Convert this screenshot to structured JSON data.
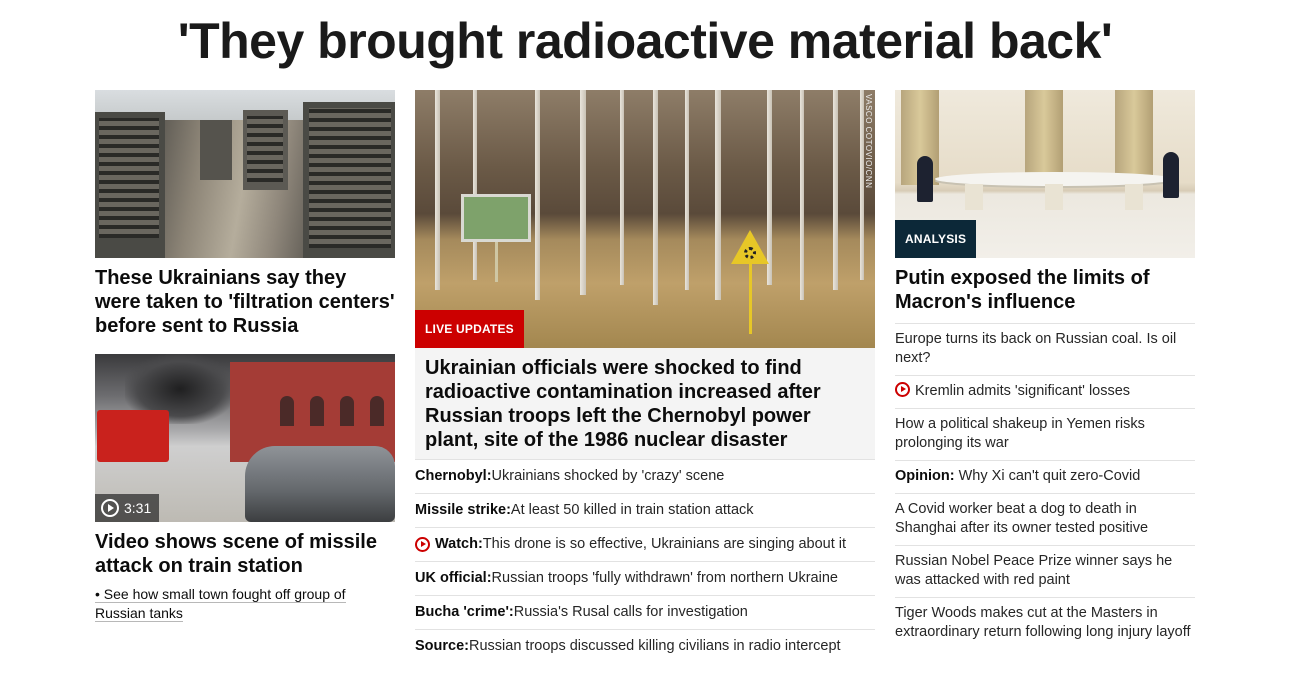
{
  "main_headline": "'They brought radioactive material back'",
  "left": {
    "story1": {
      "title": "These Ukrainians say they were taken to 'filtration centers' before sent to Russia"
    },
    "story2": {
      "duration": "3:31",
      "title": "Video shows scene of missile attack on train station",
      "sublink": "• See how small town fought off group of Russian tanks"
    }
  },
  "middle": {
    "label": "LIVE UPDATES",
    "photo_credit": "VASCO COTOVIO/CNN",
    "headline": "Ukrainian officials were shocked to find radioactive contamination increased after Russian troops left the Chernobyl power plant, site of the 1986 nuclear disaster",
    "items": [
      {
        "bold": "Chernobyl:",
        "text": " Ukrainians shocked by 'crazy' scene"
      },
      {
        "bold": "Missile strike:",
        "text": " At least 50 killed in train station attack"
      },
      {
        "bold": "Watch:",
        "text": " This drone is so effective, Ukrainians are singing about it"
      },
      {
        "bold": "UK official:",
        "text": " Russian troops 'fully withdrawn' from northern Ukraine"
      },
      {
        "bold": "Bucha 'crime':",
        "text": " Russia's Rusal calls for investigation"
      },
      {
        "bold": "Source:",
        "text": " Russian troops discussed killing civilians in radio intercept"
      }
    ]
  },
  "right": {
    "label": "ANALYSIS",
    "title": "Putin exposed the limits of Macron's influence",
    "items": [
      {
        "text": "Europe turns its back on Russian coal. Is oil next?"
      },
      {
        "text": "Kremlin admits 'significant' losses"
      },
      {
        "text": "How a political shakeup in Yemen risks prolonging its war"
      },
      {
        "bold": "Opinion:",
        "text": " Why Xi can't quit zero-Covid"
      },
      {
        "text": "A Covid worker beat a dog to death in Shanghai after its owner tested positive"
      },
      {
        "text": "Russian Nobel Peace Prize winner says he was attacked with red paint"
      },
      {
        "text": "Tiger Woods makes cut at the Masters in extraordinary return following long injury layoff"
      }
    ]
  },
  "icons": {
    "video": "play-circle-icon"
  },
  "colors": {
    "live": "#cc0000",
    "analysis": "#0c2838",
    "video_icon": "#cc0000"
  }
}
